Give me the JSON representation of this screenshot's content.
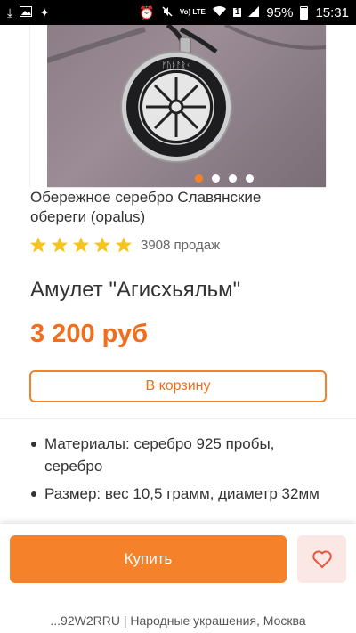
{
  "status_bar": {
    "time": "15:31",
    "battery": "95%",
    "network": "Vo) LTE",
    "sim_badge": "1",
    "icons": [
      "download-icon",
      "image-icon",
      "sparkle-icon",
      "alarm-icon",
      "mute-icon",
      "wifi-icon",
      "signal-icon",
      "battery-icon"
    ]
  },
  "product": {
    "image_alt": "amulet-pendant-photo",
    "carousel_count": 4,
    "carousel_active": 0,
    "shop_name": "Обережное серебро Славянские обереги (opalus)",
    "rating_stars": 5,
    "sales_text": "3908 продаж",
    "title": "Амулет \"Агисхьяльм\"",
    "price": "3 200 руб",
    "cart_label": "В корзину",
    "specs": [
      "Материалы:  серебро 925 пробы, серебро",
      "Размер:  вес 10,5 грамм, диаметр 32мм"
    ]
  },
  "bottom_bar": {
    "buy_label": "Купить",
    "favorite_icon": "heart-icon",
    "footer_text": "...92W2RRU | Народные украшения, Москва"
  },
  "colors": {
    "accent": "#f5822a",
    "price": "#f26d1c",
    "star": "#f7c41f",
    "fav_bg": "#fbe7e4",
    "heart": "#e8553f"
  }
}
